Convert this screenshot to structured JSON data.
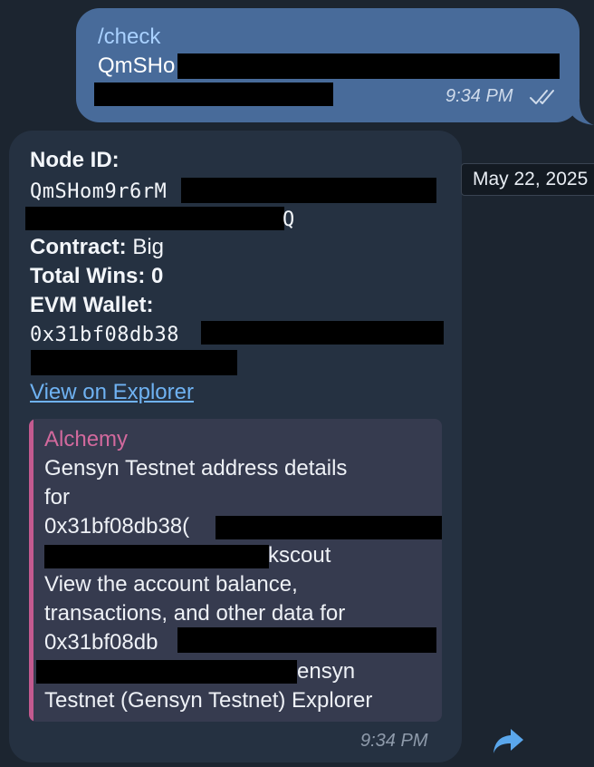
{
  "outgoing": {
    "command": "/check",
    "hash_visible": "QmSHo",
    "time": "9:34 PM"
  },
  "date_tooltip": "May 22, 2025",
  "incoming": {
    "node_id_label": "Node ID:",
    "node_id_visible": "QmSHom9r6rM",
    "node_id_tail": "Q",
    "contract_label": "Contract:",
    "contract_value": "Big",
    "total_wins": "Total Wins: 0",
    "evm_wallet_label": "EVM Wallet:",
    "wallet_visible": "0x31bf08db38",
    "explorer_link": "View on Explorer",
    "time": "9:34 PM",
    "preview": {
      "site_name": "Alchemy",
      "title_line1": "Gensyn Testnet address details",
      "title_line2": "for",
      "title_address": "0x31bf08db38(",
      "title_tail": "kscout",
      "desc_line1": "View the account balance,",
      "desc_line2": "transactions, and other data for",
      "desc_address": "0x31bf08db",
      "desc_tail": "ensyn",
      "desc_line4": "Testnet (Gensyn Testnet) Explorer"
    }
  },
  "colors": {
    "background": "#1c2530",
    "outgoing_bubble": "#486b9a",
    "incoming_bubble": "#253141",
    "link": "#6fb2f2",
    "preview_accent": "#c35a8f"
  }
}
